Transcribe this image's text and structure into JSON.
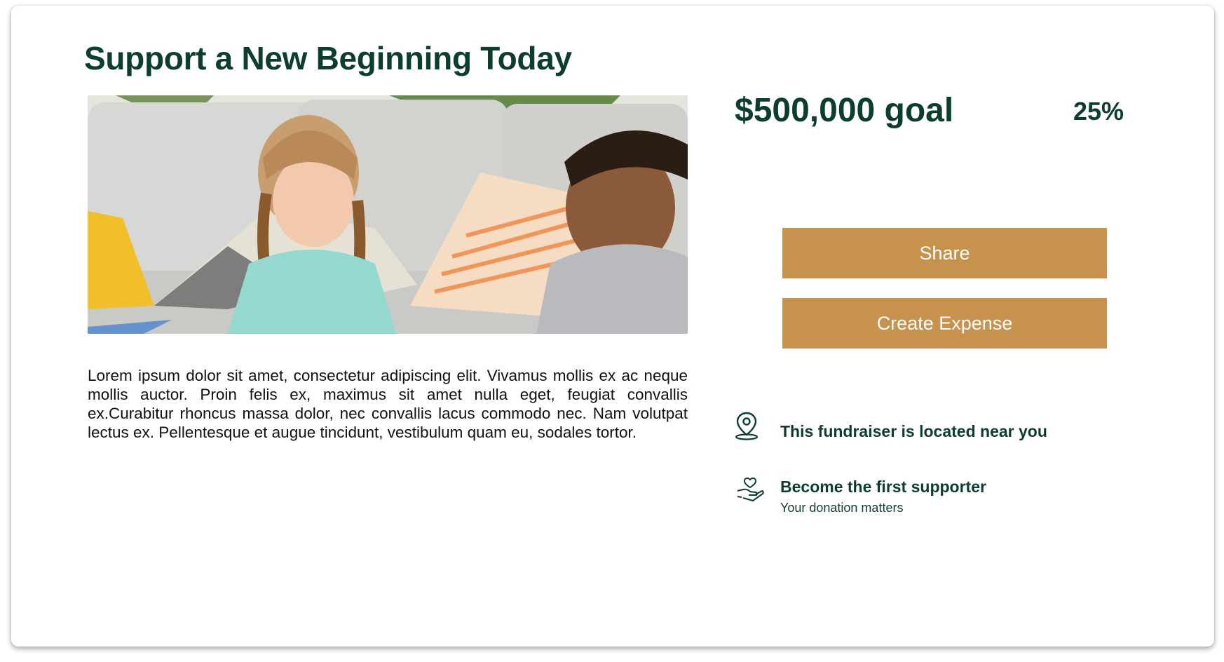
{
  "page": {
    "title": "Support a New Beginning Today",
    "description": "Lorem ipsum dolor sit amet, consectetur adipiscing elit. Vivamus mollis ex ac neque mollis auctor. Proin felis ex, maximus sit amet nulla eget, feugiat convallis ex.Curabitur rhoncus massa dolor, nec convallis lacus commodo nec. Nam volutpat lectus ex. Pellentesque et augue tincidunt, vestibulum quam eu, sodales tortor."
  },
  "fundraiser": {
    "goal_text": "$500,000 goal",
    "percent_text": "25%"
  },
  "actions": {
    "share_label": "Share",
    "create_expense_label": "Create Expense"
  },
  "info": {
    "location_text": "This fundraiser is located near you",
    "supporter_title": "Become the first supporter",
    "supporter_subtitle": "Your donation matters"
  },
  "icons": {
    "location": "map-pin-icon",
    "supporter": "hand-heart-icon"
  },
  "colors": {
    "brand_green": "#0d3d2e",
    "button_gold": "#c6924e"
  }
}
